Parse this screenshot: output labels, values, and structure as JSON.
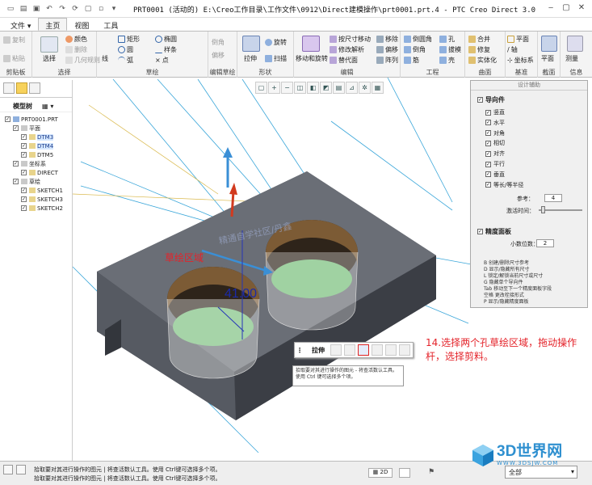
{
  "window": {
    "title": "PRT0001 (活动的) E:\\Creo工作目录\\工作文件\\0912\\Direct建模操作\\prt0001.prt.4 - PTC Creo Direct 3.0",
    "controls": [
      "‒",
      "▢",
      "✕"
    ]
  },
  "tabs": [
    "文件 ▾",
    "主页",
    "视图",
    "工具"
  ],
  "ribbon": {
    "clipboard": {
      "label": "剪贴板",
      "copy": "复制",
      "paste": "粘贴"
    },
    "select": {
      "label": "选择",
      "select": "选择",
      "color": "颜色",
      "delete": "删除",
      "geometry_rule": "几何规则"
    },
    "sketch": {
      "label": "草绘",
      "line": "线",
      "rect": "矩形",
      "ellipse": "椭圆",
      "circle": "圆",
      "spline": "样条",
      "arc": "弧",
      "point": "点"
    },
    "edit_sketch": {
      "label": "编辑草绘",
      "chamfer": "倒角",
      "offset": "偏移"
    },
    "shape": {
      "label": "形状",
      "extrude": "拉伸",
      "revolve": "旋转",
      "sweep": "扫描"
    },
    "edit": {
      "label": "编辑",
      "move_rotate": "移动和旋转",
      "move_by_dim": "按尺寸移动",
      "modify_analysis": "修改解析",
      "replace_face": "替代面",
      "mirror": "移除",
      "offset": "偏移",
      "array": "阵列"
    },
    "engineering": {
      "label": "工程",
      "round": "倒圆角",
      "chamfer": "倒角",
      "rib": "筋",
      "hole": "孔",
      "draft": "拔模",
      "shell": "壳"
    },
    "surface": {
      "label": "曲面",
      "merge": "合并",
      "repair": "修复",
      "solidify": "实体化"
    },
    "datum": {
      "label": "基准",
      "plane": "平面",
      "axis": "轴",
      "csys": "坐标系"
    },
    "section": {
      "label": "截面",
      "plane": "平面"
    },
    "info": {
      "label": "信息",
      "measure": "测量"
    }
  },
  "model_tree": {
    "header": "模型树",
    "items": [
      {
        "label": "PRT0001.PRT",
        "indent": 0
      },
      {
        "label": "平面",
        "indent": 1
      },
      {
        "label": "DTM3",
        "indent": 2,
        "highlight": true
      },
      {
        "label": "DTM4",
        "indent": 2,
        "highlight": true
      },
      {
        "label": "DTM5",
        "indent": 2
      },
      {
        "label": "坐标系",
        "indent": 1
      },
      {
        "label": "DIRECT",
        "indent": 2
      },
      {
        "label": "草绘",
        "indent": 1
      },
      {
        "label": "SKETCH1",
        "indent": 2
      },
      {
        "label": "SKETCH3",
        "indent": 2
      },
      {
        "label": "SKETCH2",
        "indent": 2
      }
    ]
  },
  "design_assist": {
    "title": "设计辅助",
    "guides": {
      "header": "导向件",
      "options": [
        "竖直",
        "水平",
        "对角",
        "相切",
        "对齐",
        "平行",
        "垂直",
        "等长/等半径"
      ]
    },
    "reference_label": "参考：",
    "reference_value": "4",
    "snap_label": "激活时间：",
    "precision": {
      "header": "精度面板",
      "decimals_label": "小数位数：",
      "decimals_value": "2"
    },
    "help_lines": [
      "B 创建/删除尺寸参考",
      "D 显示/隐藏所有尺寸",
      "L 锁定/解锁当前尺寸或尺寸",
      "G 隐藏单个导向件",
      "Tab 移动至下一个精度面板字段",
      "空格 更改栓接形式",
      "P 显示/隐藏精度面板"
    ]
  },
  "viewport": {
    "dimension": "41.00",
    "sketch_region_label": "草绘区域",
    "watermark_text": "精通自学社区/丹鑫"
  },
  "mini_toolbar": {
    "label": "拉伸"
  },
  "tooltip": "拾取要对其进行操作的图元 - 将查活数认工具。使用 Ctrl 键可选择多个项。",
  "annotation": "14.选择两个孔草绘区域，拖动操作杆，选择剪料。",
  "status": {
    "line1": "拾取要对其进行操作的图元 | 将查活数认工具。使用 Ctrl键可选择多个项。",
    "line2": "拾取要对其进行操作的图元 | 将查活数认工具。使用 Ctrl键可选择多个项。",
    "filter": "全部"
  },
  "watermark": {
    "brand": "3D世界网",
    "url": "WWW.3DSJW.COM"
  },
  "colors": {
    "accent": "#1f6fc5",
    "annotation": "#e4232a",
    "body": "#5c6068",
    "sketch_fill": "#78c57c"
  }
}
